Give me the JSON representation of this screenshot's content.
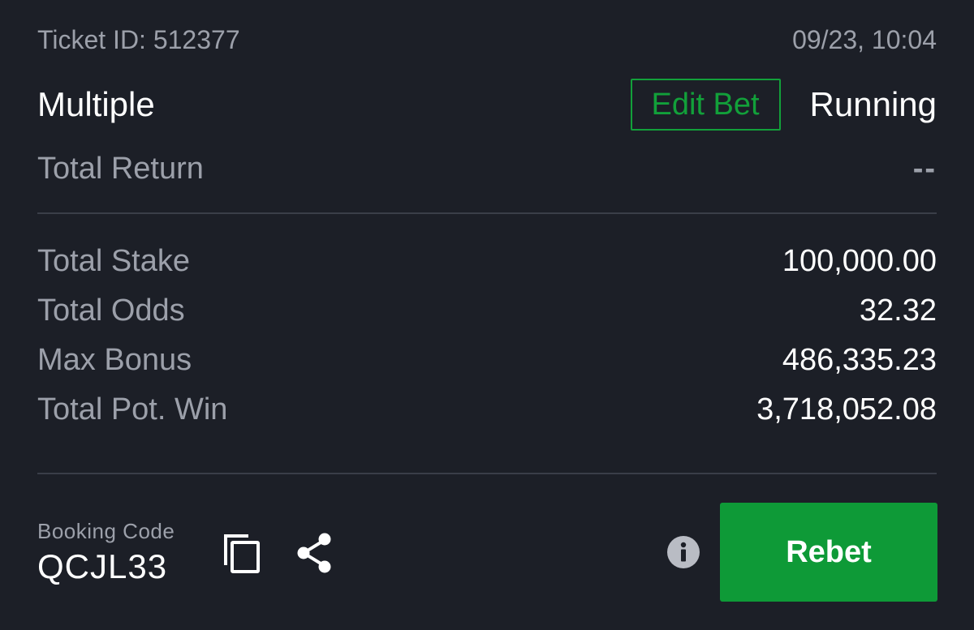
{
  "ticket": {
    "id_text": "Ticket ID: 512377",
    "datetime": "09/23, 10:04",
    "bet_type": "Multiple",
    "edit_label": "Edit Bet",
    "status": "Running",
    "total_return_label": "Total Return",
    "total_return_value": "--"
  },
  "stats": [
    {
      "label": "Total Stake",
      "value": "100,000.00"
    },
    {
      "label": "Total Odds",
      "value": "32.32"
    },
    {
      "label": "Max Bonus",
      "value": "486,335.23"
    },
    {
      "label": "Total Pot. Win",
      "value": "3,718,052.08"
    }
  ],
  "booking": {
    "label": "Booking Code",
    "code": "QCJL33"
  },
  "actions": {
    "rebet_label": "Rebet"
  },
  "icons": {
    "copy": "copy-icon",
    "share": "share-icon",
    "info": "info-icon"
  },
  "colors": {
    "background": "#1c1f27",
    "accent_green": "#0e9a37",
    "muted_text": "#9ca0aa"
  }
}
